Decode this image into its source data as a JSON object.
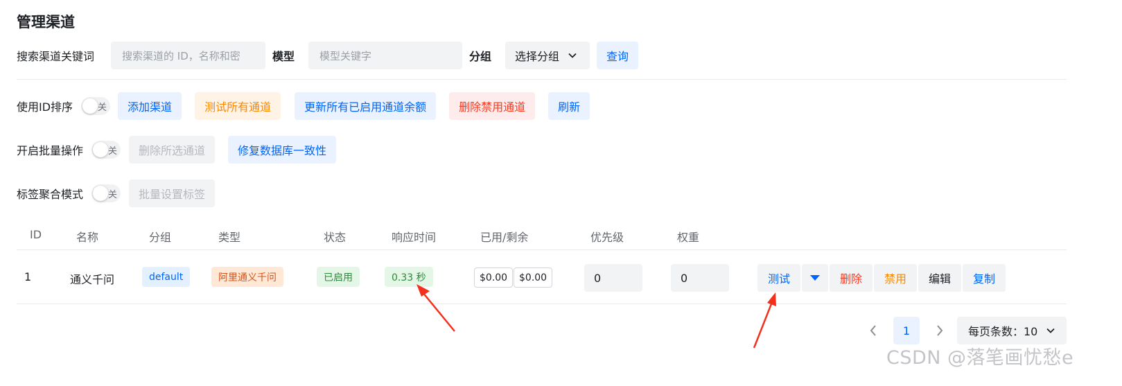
{
  "page_title": "管理渠道",
  "search": {
    "keyword_label": "搜索渠道关键词",
    "keyword_placeholder": "搜索渠道的 ID，名称和密",
    "model_label": "模型",
    "model_placeholder": "模型关键字",
    "group_label": "分组",
    "group_select": "选择分组",
    "query_button": "查询"
  },
  "toolbar": {
    "sort_by_id_label": "使用ID排序",
    "switch_off_text": "关",
    "add_channel": "添加渠道",
    "test_all": "测试所有通道",
    "update_balance": "更新所有已启用通道余额",
    "delete_disabled": "删除禁用通道",
    "refresh": "刷新",
    "batch_label": "开启批量操作",
    "delete_selected": "删除所选通道",
    "fix_db": "修复数据库一致性",
    "tag_mode_label": "标签聚合模式",
    "batch_set_tag": "批量设置标签"
  },
  "table": {
    "headers": [
      "ID",
      "名称",
      "分组",
      "类型",
      "状态",
      "响应时间",
      "已用/剩余",
      "优先级",
      "权重"
    ],
    "rows": [
      {
        "id": "1",
        "name": "通义千问",
        "group": "default",
        "type": "阿里通义千问",
        "status": "已启用",
        "response_time": "0.33 秒",
        "used": "$0.00",
        "remaining": "$0.00",
        "priority": "0",
        "weight": "0",
        "actions": {
          "test": "测试",
          "delete": "删除",
          "disable": "禁用",
          "edit": "编辑",
          "copy": "复制"
        }
      }
    ]
  },
  "pagination": {
    "current_page": "1",
    "page_size_label": "每页条数：10"
  },
  "watermark": "CSDN @落笔画忧愁e",
  "colors": {
    "primary": "#0064fa",
    "warning": "#fc8800",
    "danger": "#f93920",
    "success": "#2a8a37",
    "annotation_arrow": "#f4301c"
  }
}
